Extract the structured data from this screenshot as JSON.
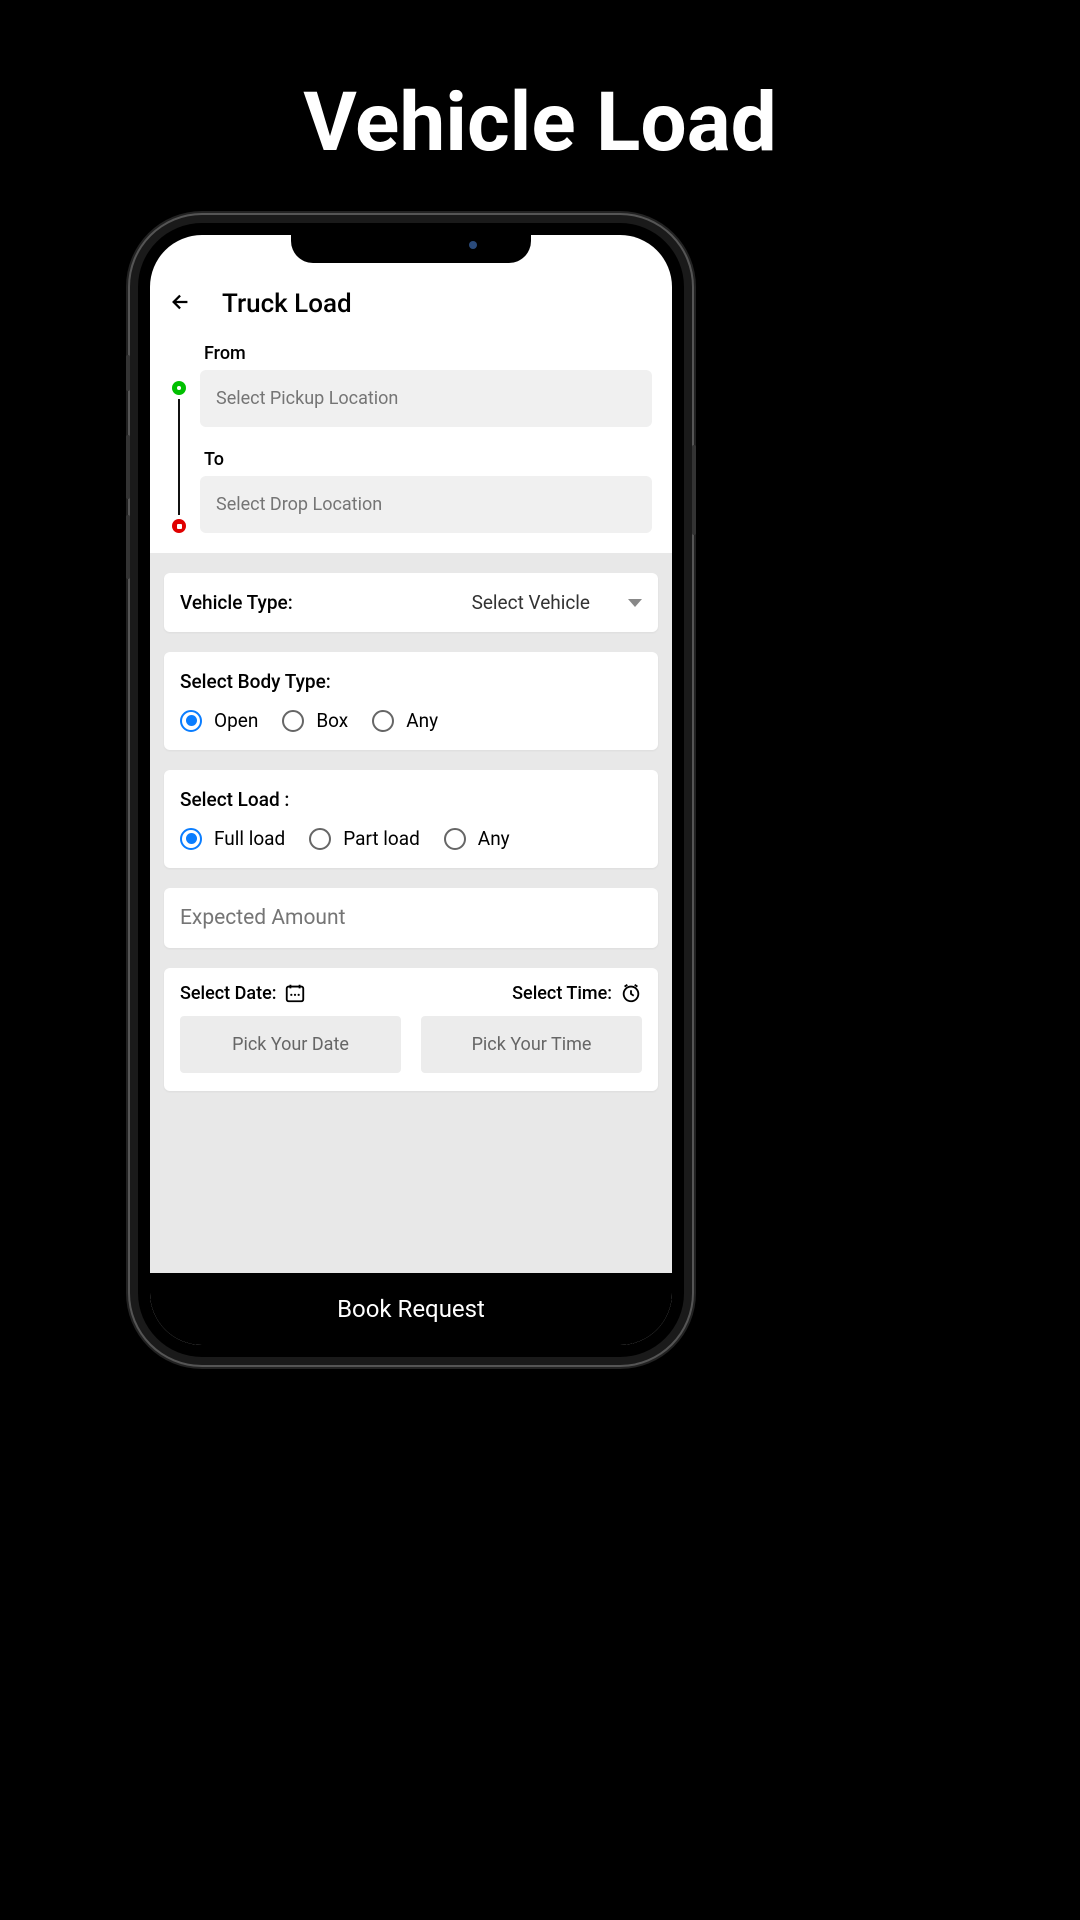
{
  "page_title": "Vehicle Load",
  "header": {
    "title": "Truck Load"
  },
  "location": {
    "from_label": "From",
    "from_placeholder": "Select Pickup Location",
    "to_label": "To",
    "to_placeholder": "Select Drop Location"
  },
  "vehicle_type": {
    "label": "Vehicle Type:",
    "value": "Select Vehicle"
  },
  "body_type": {
    "label": "Select Body Type:",
    "options": [
      "Open",
      "Box",
      "Any"
    ],
    "selected": "Open"
  },
  "load": {
    "label": "Select Load :",
    "options": [
      "Full load",
      "Part load",
      "Any"
    ],
    "selected": "Full load"
  },
  "expected_amount": {
    "placeholder": "Expected Amount"
  },
  "datetime": {
    "date_label": "Select Date:",
    "date_button": "Pick Your Date",
    "time_label": "Select Time:",
    "time_button": "Pick Your Time"
  },
  "book_button": "Book Request"
}
